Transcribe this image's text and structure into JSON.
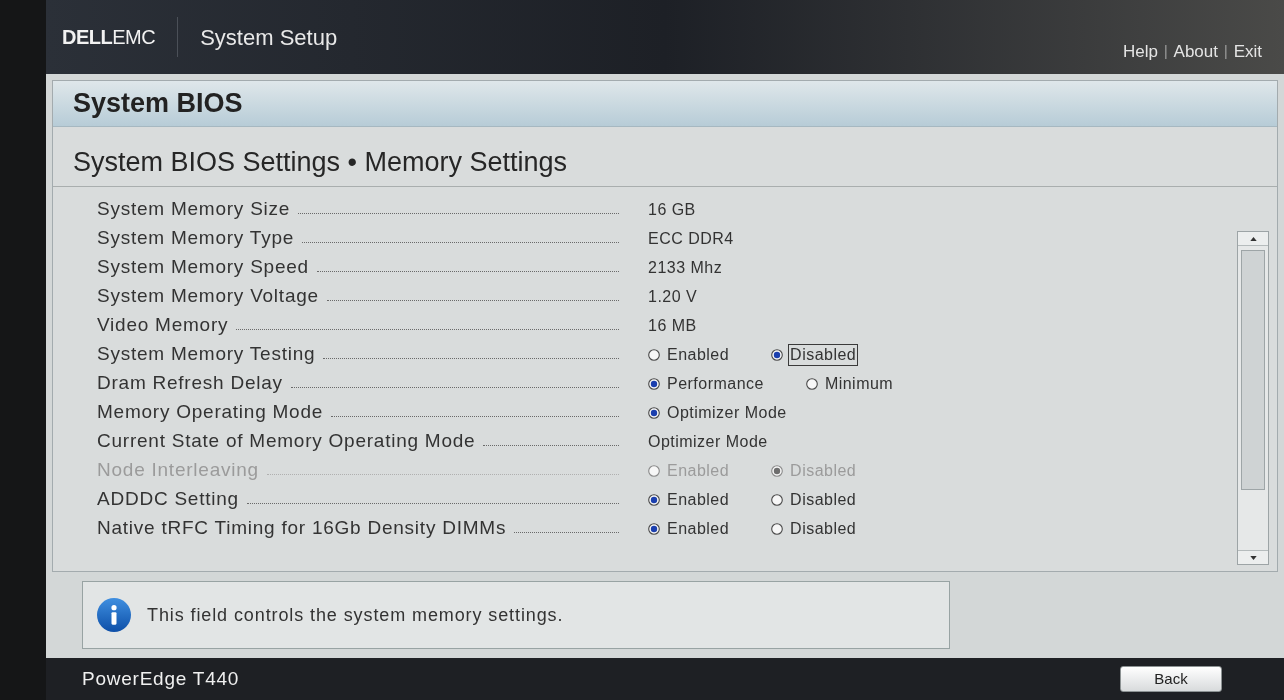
{
  "header": {
    "logo": "**DELL**EMC",
    "title": "System Setup",
    "links": [
      {
        "kind": "link",
        "text": "Help"
      },
      {
        "kind": "separator",
        "text": "|"
      },
      {
        "kind": "link",
        "text": "About"
      },
      {
        "kind": "separator",
        "text": "|"
      },
      {
        "kind": "link",
        "text": "Exit"
      }
    ]
  },
  "page": {
    "title": "System BIOS",
    "breadcrumb": "System BIOS Settings • Memory Settings"
  },
  "settings": [
    {
      "label": "System Memory Size",
      "disabled": false,
      "kind": "value",
      "value": "16 GB"
    },
    {
      "label": "System Memory Type",
      "disabled": false,
      "kind": "value",
      "value": "ECC DDR4"
    },
    {
      "label": "System Memory Speed",
      "disabled": false,
      "kind": "value",
      "value": "2133 Mhz"
    },
    {
      "label": "System Memory Voltage",
      "disabled": false,
      "kind": "value",
      "value": "1.20 V"
    },
    {
      "label": "Video Memory",
      "disabled": false,
      "kind": "value",
      "value": "16 MB"
    },
    {
      "label": "System Memory Testing",
      "disabled": false,
      "kind": "radio",
      "options": [
        {
          "label": "Enabled",
          "selected": false,
          "focused": false
        },
        {
          "label": "Disabled",
          "selected": true,
          "focused": true
        }
      ]
    },
    {
      "label": "Dram Refresh Delay",
      "disabled": false,
      "kind": "radio",
      "options": [
        {
          "label": "Performance",
          "selected": true,
          "focused": false
        },
        {
          "label": "Minimum",
          "selected": false,
          "focused": false
        }
      ]
    },
    {
      "label": "Memory Operating Mode",
      "disabled": false,
      "kind": "radio",
      "options": [
        {
          "label": "Optimizer Mode",
          "selected": true,
          "focused": false
        }
      ]
    },
    {
      "label": "Current State of Memory Operating Mode",
      "disabled": false,
      "kind": "value",
      "value": "Optimizer Mode"
    },
    {
      "label": "Node Interleaving",
      "disabled": true,
      "kind": "radio",
      "options": [
        {
          "label": "Enabled",
          "selected": false,
          "focused": false
        },
        {
          "label": "Disabled",
          "selected": true,
          "focused": false
        }
      ]
    },
    {
      "label": "ADDDC Setting",
      "disabled": false,
      "kind": "radio",
      "options": [
        {
          "label": "Enabled",
          "selected": true,
          "focused": false
        },
        {
          "label": "Disabled",
          "selected": false,
          "focused": false
        }
      ]
    },
    {
      "label": "Native tRFC Timing for 16Gb Density DIMMs",
      "disabled": false,
      "kind": "radio",
      "options": [
        {
          "label": "Enabled",
          "selected": true,
          "focused": false
        },
        {
          "label": "Disabled",
          "selected": false,
          "focused": false
        }
      ]
    }
  ],
  "help": {
    "text": "This field controls the system memory settings."
  },
  "footer": {
    "model": "PowerEdge T440",
    "button": "Back"
  }
}
